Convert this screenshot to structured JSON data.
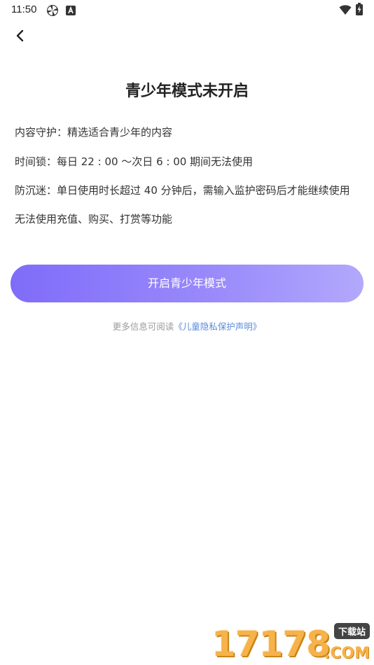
{
  "status_bar": {
    "time": "11:50",
    "left_icons": [
      "pinwheel-icon",
      "a-letter-icon"
    ],
    "right_icons": [
      "wifi-icon",
      "battery-charging-icon"
    ]
  },
  "nav": {
    "back_icon": "chevron-left-icon"
  },
  "title": "青少年模式未开启",
  "features": [
    "内容守护：精选适合青少年的内容",
    "时间锁：每日 22 : 00 ～次日 6 : 00 期间无法使用",
    "防沉迷：单日使用时长超过 40 分钟后，需输入监护密码后才能继续使用",
    "无法使用充值、购买、打赏等功能"
  ],
  "button": {
    "label": "开启青少年模式"
  },
  "footnote": {
    "prefix": "更多信息可阅读",
    "link": "《儿童隐私保护声明》"
  },
  "watermark": {
    "number": "17178",
    "badge": "下载站",
    "domain": ".COM"
  },
  "colors": {
    "button_start": "#7f6cf9",
    "button_end": "#b2a8fc",
    "link": "#5b8cdb",
    "watermark": "#f7b24a"
  }
}
